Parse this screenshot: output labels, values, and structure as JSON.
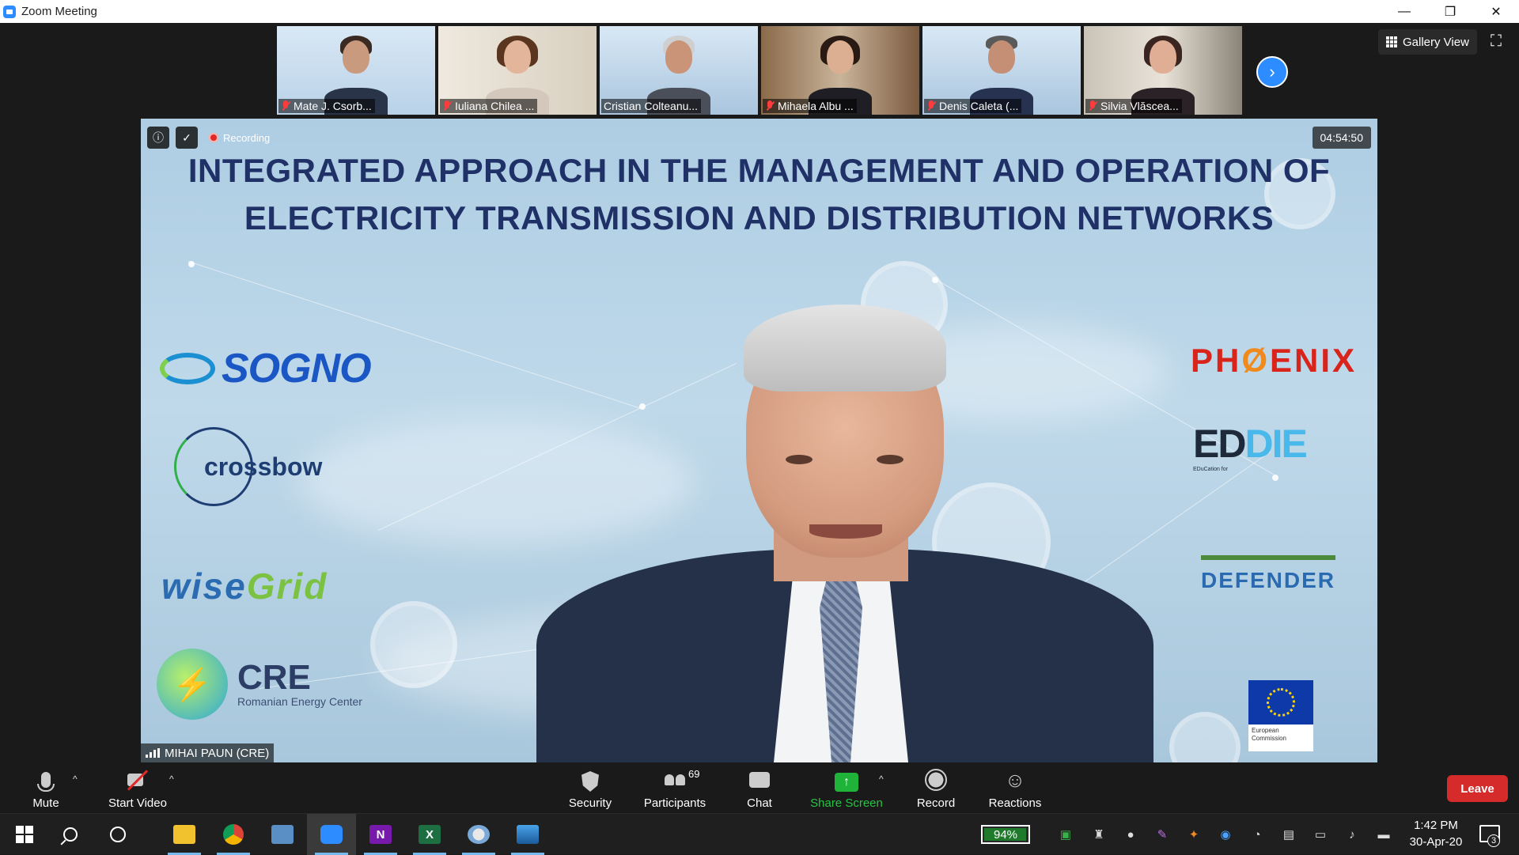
{
  "window": {
    "title": "Zoom Meeting",
    "controls": [
      "—",
      "❐",
      "✕"
    ]
  },
  "gallery": {
    "participants": [
      {
        "name": "Mate J. Csorb...",
        "muted": true,
        "icon": "muted-mic-icon"
      },
      {
        "name": "Iuliana Chilea ...",
        "muted": true,
        "icon": "muted-mic-icon"
      },
      {
        "name": "Cristian Colteanu...",
        "muted": false,
        "icon": ""
      },
      {
        "name": "Mihaela Albu ...",
        "muted": true,
        "icon": "muted-mic-icon"
      },
      {
        "name": "Denis Caleta (...",
        "muted": true,
        "icon": "muted-mic-icon"
      },
      {
        "name": "Silvia Vlăscea...",
        "muted": true,
        "icon": "muted-mic-icon"
      }
    ],
    "next_icon": "›",
    "view_label": "Gallery View",
    "fullscreen_icon": "⛶"
  },
  "active_video": {
    "recording_label": "Recording",
    "timer": "04:54:50",
    "speaker_name": "MIHAI PAUN (CRE)",
    "slide_title_line1": "INTEGRATED APPROACH IN THE MANAGEMENT AND OPERATION OF",
    "slide_title_line2": "ELECTRICITY TRANSMISSION AND DISTRIBUTION NETWORKS",
    "logos_left": {
      "sogno": "SOGNO",
      "crossbow": "crossbow",
      "wisegrid_a": "wise",
      "wisegrid_b": "Grid",
      "cre": "CRE",
      "cre_sub": "Romanian Energy Center"
    },
    "logos_right": {
      "phoenix_a": "PH",
      "phoenix_b": "Ø",
      "phoenix_c": "ENIX",
      "eddie_a": "ED",
      "eddie_b": "DIE",
      "eddie_sub": "EDuCation for",
      "defender": "DEFENDER",
      "ec": "European Commission"
    }
  },
  "toolbar": {
    "mute": "Mute",
    "start_video": "Start Video",
    "security": "Security",
    "participants": "Participants",
    "participant_count": "69",
    "chat": "Chat",
    "share_screen": "Share Screen",
    "share_arrow": "↑",
    "record": "Record",
    "reactions": "Reactions",
    "leave": "Leave",
    "caret": "^"
  },
  "taskbar": {
    "battery": "94%",
    "time": "1:42 PM",
    "date": "30-Apr-20",
    "notifications": "3",
    "apps": [
      "File Explorer",
      "Chrome",
      "Remote Desktop",
      "Zoom",
      "OneNote",
      "Excel",
      "Paint",
      "Photos"
    ],
    "onenote_letter": "N",
    "excel_letter": "X"
  },
  "colors": {
    "zoom_blue": "#2d8cff",
    "leave_red": "#d62b2b",
    "share_green": "#20b33a",
    "slide_title": "#1f3167"
  }
}
